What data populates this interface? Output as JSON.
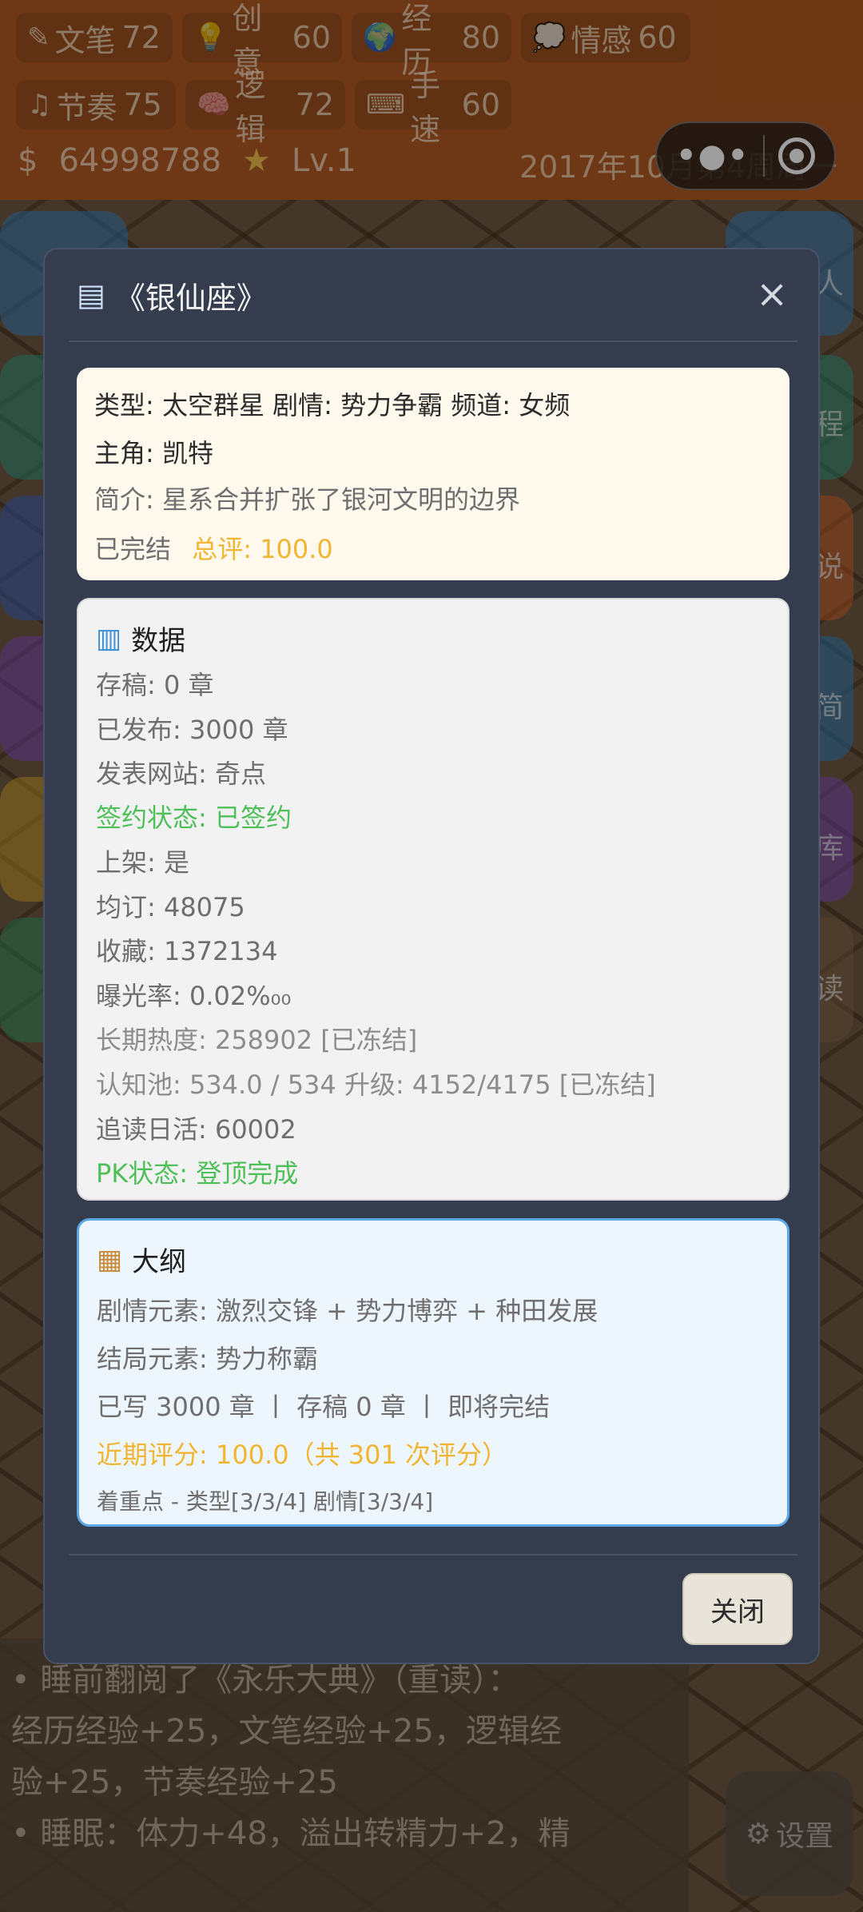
{
  "background": {
    "stats": [
      {
        "icon": "✎",
        "label": "文笔",
        "value": "72"
      },
      {
        "icon": "💡",
        "label": "创意",
        "value": "60"
      },
      {
        "icon": "🌍",
        "label": "经历",
        "value": "80"
      },
      {
        "icon": "💭",
        "label": "情感",
        "value": "60"
      },
      {
        "icon": "♫",
        "label": "节奏",
        "value": "75"
      },
      {
        "icon": "🧠",
        "label": "逻辑",
        "value": "72"
      },
      {
        "icon": "⌨",
        "label": "手速",
        "value": "60"
      }
    ],
    "money": "64998788",
    "level": "Lv.1",
    "date": "2017年10月第4周周一",
    "side_labels": [
      "人",
      "程",
      "说",
      "简",
      "库",
      "读"
    ],
    "log_lines": [
      "• 睡前翻阅了《永乐大典》（重读）：",
      "经历经验+25，文笔经验+25，逻辑经",
      "验+25，节奏经验+25",
      "• 睡眠：体力+48，溢出转精力+2，精"
    ],
    "settings_label": "设置"
  },
  "modal": {
    "title": "《银仙座》",
    "info": {
      "meta": "类型: 太空群星  剧情: 势力争霸  频道: 女频",
      "protagonist": "主角: 凯特",
      "synopsis": "简介: 星系合并扩张了银河文明的边界",
      "status": "已完结",
      "score": "总评: 100.0"
    },
    "data_section": {
      "title": "数据",
      "drafts": "存稿: 0 章",
      "published": "已发布: 3000 章",
      "site": "发表网站: 奇点",
      "contract": "签约状态: 已签约",
      "listed": "上架: 是",
      "avg_sub": "均订: 48075",
      "favorites": "收藏: 1372134",
      "exposure": "曝光率: 0.02%₀₀",
      "heat": "长期热度: 258902 [已冻结]",
      "cognition": "认知池: 534.0 / 534  升级: 4152/4175 [已冻结]",
      "daily_readers": "追读日活: 60002",
      "pk": "PK状态: 登顶完成"
    },
    "outline_section": {
      "title": "大纲",
      "plot_elements": "剧情元素: 激烈交锋 + 势力博弈 + 种田发展",
      "ending": "结局元素: 势力称霸",
      "progress": "已写 3000 章 丨 存稿 0 章 丨 即将完结",
      "recent_score": "近期评分: 100.0（共 301 次评分）",
      "focus": "着重点 - 类型[3/3/4] 剧情[3/3/4]"
    },
    "close_label": "关闭"
  },
  "colors": {
    "modal_bg": "#343c4d",
    "info_card_bg": "#fef9ec",
    "outline_border": "#5ba7e6",
    "green": "#4fbf5a",
    "gold": "#f0b533"
  }
}
